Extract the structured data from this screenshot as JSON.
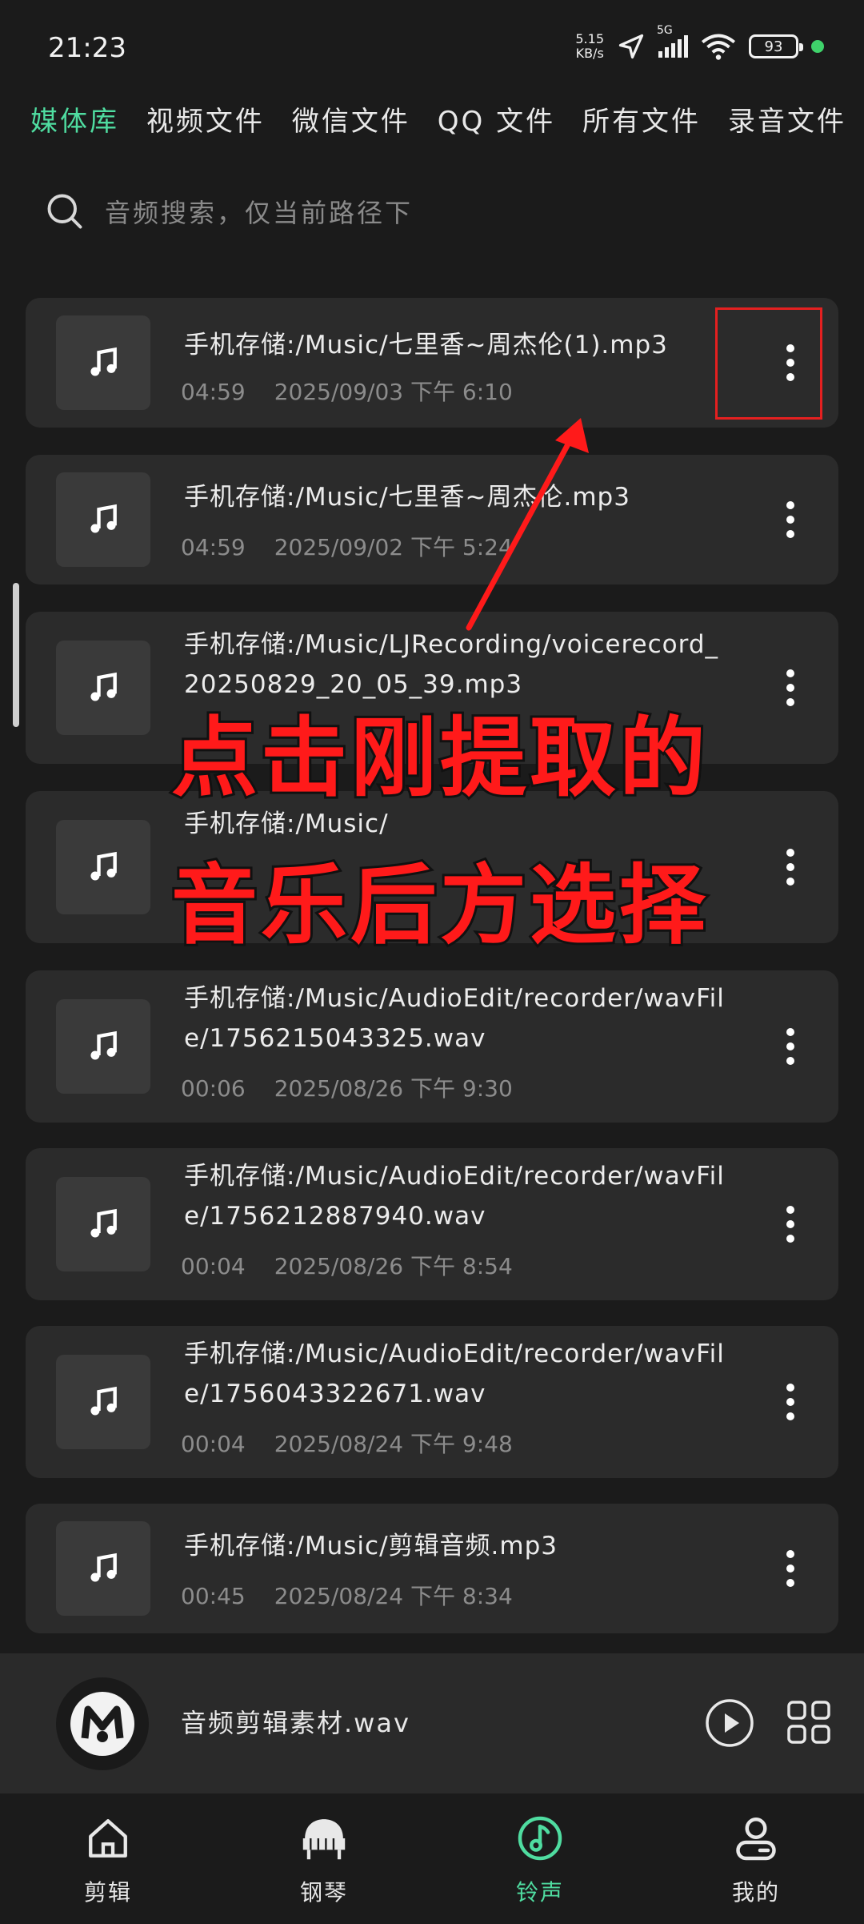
{
  "status": {
    "time": "21:23",
    "net_speed_value": "5.15",
    "net_speed_unit": "KB/s",
    "network": "5G",
    "battery": "93"
  },
  "tabs": [
    {
      "label": "媒体库",
      "active": true
    },
    {
      "label": "视频文件"
    },
    {
      "label": "微信文件"
    },
    {
      "label": "QQ 文件"
    },
    {
      "label": "所有文件"
    },
    {
      "label": "录音文件"
    }
  ],
  "search": {
    "placeholder": "音频搜索，仅当前路径下"
  },
  "items": [
    {
      "title": "手机存储:/Music/七里香~周杰伦(1).mp3",
      "duration": "04:59",
      "datetime": "2025/09/03 下午 6:10"
    },
    {
      "title": "手机存储:/Music/七里香~周杰伦.mp3",
      "duration": "04:59",
      "datetime": "2025/09/02 下午 5:24"
    },
    {
      "title": "手机存储:/Music/LJRecording/voicerecord_20250829_20_05_39.mp3",
      "duration": "",
      "datetime": ""
    },
    {
      "title": "手机存储:/Music/",
      "duration": "",
      "datetime": ""
    },
    {
      "title": "手机存储:/Music/AudioEdit/recorder/wavFile/1756215043325.wav",
      "duration": "00:06",
      "datetime": "2025/08/26 下午 9:30"
    },
    {
      "title": "手机存储:/Music/AudioEdit/recorder/wavFile/1756212887940.wav",
      "duration": "00:04",
      "datetime": "2025/08/26 下午 8:54"
    },
    {
      "title": "手机存储:/Music/AudioEdit/recorder/wavFile/1756043322671.wav",
      "duration": "00:04",
      "datetime": "2025/08/24 下午 9:48"
    },
    {
      "title": "手机存储:/Music/剪辑音频.mp3",
      "duration": "00:45",
      "datetime": "2025/08/24 下午 8:34"
    }
  ],
  "overlay": {
    "line1": "点击刚提取的",
    "line2": "音乐后方选择"
  },
  "player": {
    "title": "音频剪辑素材.wav"
  },
  "nav": [
    {
      "label": "剪辑",
      "icon": "home-icon"
    },
    {
      "label": "钢琴",
      "icon": "piano-icon"
    },
    {
      "label": "铃声",
      "icon": "music-note-icon",
      "active": true
    },
    {
      "label": "我的",
      "icon": "person-icon"
    }
  ],
  "colors": {
    "accent": "#4fdca0",
    "annotation_red": "#ff1a1a",
    "background": "#1b1b1b",
    "card": "#2b2b2b"
  }
}
